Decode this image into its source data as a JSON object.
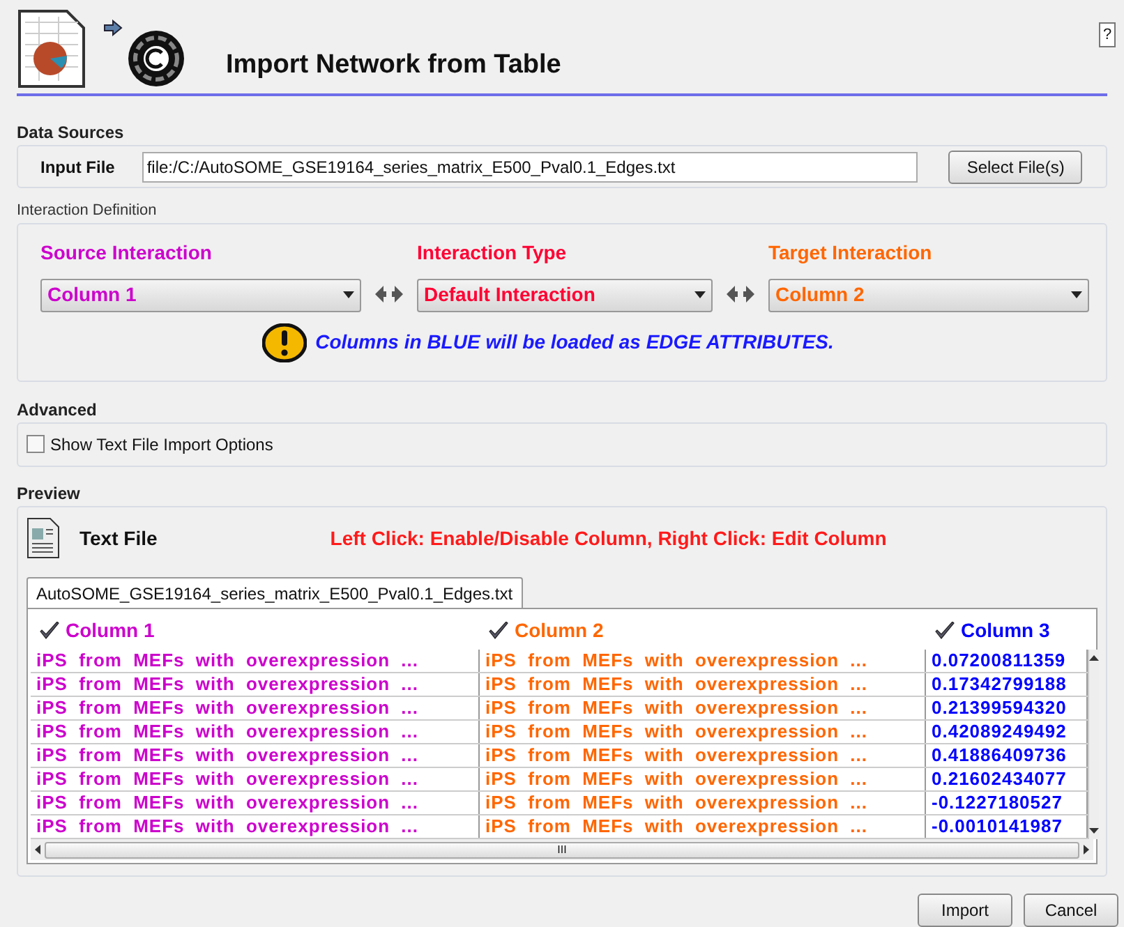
{
  "window": {
    "title": "Import Network from Table",
    "help": "?"
  },
  "data_sources": {
    "legend": "Data Sources",
    "input_label": "Input File",
    "input_value": "file:/C:/AutoSOME_GSE19164_series_matrix_E500_Pval0.1_Edges.txt",
    "button": "Select File(s)"
  },
  "interaction": {
    "legend": "Interaction Definition",
    "selectors": [
      {
        "label": "Source Interaction",
        "value": "Column 1",
        "color": "#cc00cc"
      },
      {
        "label": "Interaction Type",
        "value": "Default Interaction",
        "color": "#ff0033"
      },
      {
        "label": "Target Interaction",
        "value": "Column 2",
        "color": "#ff6600"
      }
    ],
    "note": "Columns in BLUE will be loaded as EDGE ATTRIBUTES."
  },
  "advanced": {
    "legend": "Advanced",
    "option": {
      "label": "Show Text File Import Options",
      "checked": false
    }
  },
  "preview": {
    "legend": "Preview",
    "file_type": "Text File",
    "hint": "Left Click: Enable/Disable Column, Right Click: Edit Column",
    "tabs": [
      {
        "label": "AutoSOME_GSE19164_series_matrix_E500_Pval0.1_Edges.txt",
        "selected": true
      }
    ],
    "columns": [
      {
        "name": "Column 1",
        "enabled": true,
        "color": "#cc00cc"
      },
      {
        "name": "Column 2",
        "enabled": true,
        "color": "#ff6600"
      },
      {
        "name": "Column 3",
        "enabled": true,
        "color": "#0000ff"
      }
    ],
    "rows": [
      [
        "iPS from MEFs with overexpression ...",
        "iPS from MEFs with overexpression ...",
        "0.07200811359"
      ],
      [
        "iPS from MEFs with overexpression ...",
        "iPS from MEFs with overexpression ...",
        "0.17342799188"
      ],
      [
        "iPS from MEFs with overexpression ...",
        "iPS from MEFs with overexpression ...",
        "0.21399594320"
      ],
      [
        "iPS from MEFs with overexpression ...",
        "iPS from MEFs with overexpression ...",
        "0.42089249492"
      ],
      [
        "iPS from MEFs with overexpression ...",
        "iPS from MEFs with overexpression ...",
        "0.41886409736"
      ],
      [
        "iPS from MEFs with overexpression ...",
        "iPS from MEFs with overexpression ...",
        "0.21602434077"
      ],
      [
        "iPS from MEFs with overexpression ...",
        "iPS from MEFs with overexpression ...",
        "-0.1227180527"
      ],
      [
        "iPS from MEFs with overexpression ...",
        "iPS from MEFs with overexpression ...",
        "-0.0010141987"
      ]
    ],
    "scroll_grip": "III"
  },
  "buttons": [
    "Import",
    "Cancel"
  ]
}
